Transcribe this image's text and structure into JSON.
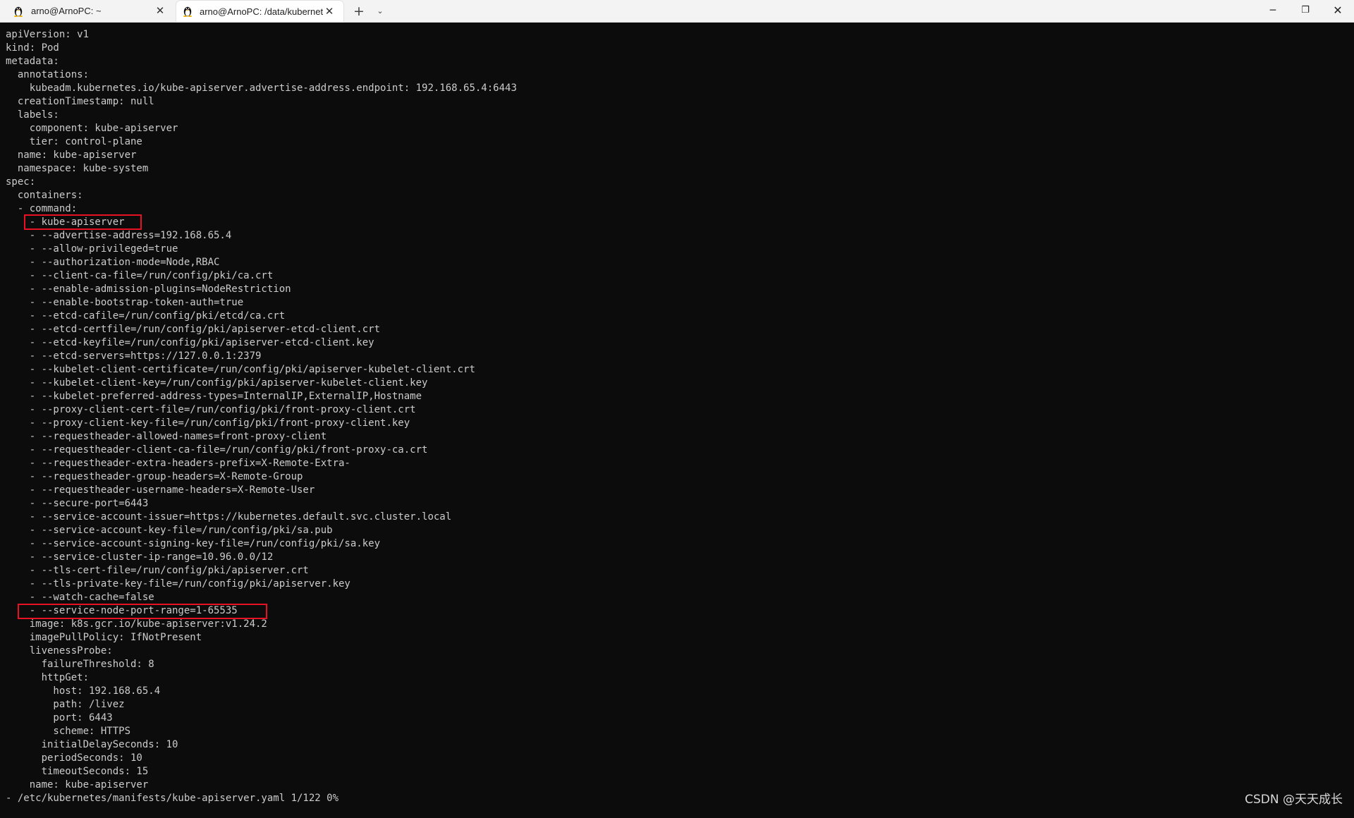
{
  "tabs": [
    {
      "title": "arno@ArnoPC: ~",
      "icon": "linux-penguin-icon",
      "active": false
    },
    {
      "title": "arno@ArnoPC: /data/kubernetes",
      "icon": "linux-penguin-icon",
      "active": true
    }
  ],
  "tabbar": {
    "close_glyph": "✕",
    "new_tab_glyph": "+",
    "dropdown_glyph": "⌄"
  },
  "window_controls": {
    "minimize": "─",
    "maximize": "❐",
    "close": "✕"
  },
  "terminal": {
    "lines": [
      "apiVersion: v1",
      "kind: Pod",
      "metadata:",
      "  annotations:",
      "    kubeadm.kubernetes.io/kube-apiserver.advertise-address.endpoint: 192.168.65.4:6443",
      "  creationTimestamp: null",
      "  labels:",
      "    component: kube-apiserver",
      "    tier: control-plane",
      "  name: kube-apiserver",
      "  namespace: kube-system",
      "spec:",
      "  containers:",
      "  - command:",
      "    - kube-apiserver",
      "    - --advertise-address=192.168.65.4",
      "    - --allow-privileged=true",
      "    - --authorization-mode=Node,RBAC",
      "    - --client-ca-file=/run/config/pki/ca.crt",
      "    - --enable-admission-plugins=NodeRestriction",
      "    - --enable-bootstrap-token-auth=true",
      "    - --etcd-cafile=/run/config/pki/etcd/ca.crt",
      "    - --etcd-certfile=/run/config/pki/apiserver-etcd-client.crt",
      "    - --etcd-keyfile=/run/config/pki/apiserver-etcd-client.key",
      "    - --etcd-servers=https://127.0.0.1:2379",
      "    - --kubelet-client-certificate=/run/config/pki/apiserver-kubelet-client.crt",
      "    - --kubelet-client-key=/run/config/pki/apiserver-kubelet-client.key",
      "    - --kubelet-preferred-address-types=InternalIP,ExternalIP,Hostname",
      "    - --proxy-client-cert-file=/run/config/pki/front-proxy-client.crt",
      "    - --proxy-client-key-file=/run/config/pki/front-proxy-client.key",
      "    - --requestheader-allowed-names=front-proxy-client",
      "    - --requestheader-client-ca-file=/run/config/pki/front-proxy-ca.crt",
      "    - --requestheader-extra-headers-prefix=X-Remote-Extra-",
      "    - --requestheader-group-headers=X-Remote-Group",
      "    - --requestheader-username-headers=X-Remote-User",
      "    - --secure-port=6443",
      "    - --service-account-issuer=https://kubernetes.default.svc.cluster.local",
      "    - --service-account-key-file=/run/config/pki/sa.pub",
      "    - --service-account-signing-key-file=/run/config/pki/sa.key",
      "    - --service-cluster-ip-range=10.96.0.0/12",
      "    - --tls-cert-file=/run/config/pki/apiserver.crt",
      "    - --tls-private-key-file=/run/config/pki/apiserver.key",
      "    - --watch-cache=false",
      "    - --service-node-port-range=1-65535",
      "    image: k8s.gcr.io/kube-apiserver:v1.24.2",
      "    imagePullPolicy: IfNotPresent",
      "    livenessProbe:",
      "      failureThreshold: 8",
      "      httpGet:",
      "        host: 192.168.65.4",
      "        path: /livez",
      "        port: 6443",
      "        scheme: HTTPS",
      "      initialDelaySeconds: 10",
      "      periodSeconds: 10",
      "      timeoutSeconds: 15",
      "    name: kube-apiserver",
      "- /etc/kubernetes/manifests/kube-apiserver.yaml 1/122 0%"
    ]
  },
  "colors": {
    "terminal_bg": "#0c0c0c",
    "terminal_fg": "#cccccc",
    "highlight": "#e81123"
  },
  "watermark": "CSDN @天天成长"
}
